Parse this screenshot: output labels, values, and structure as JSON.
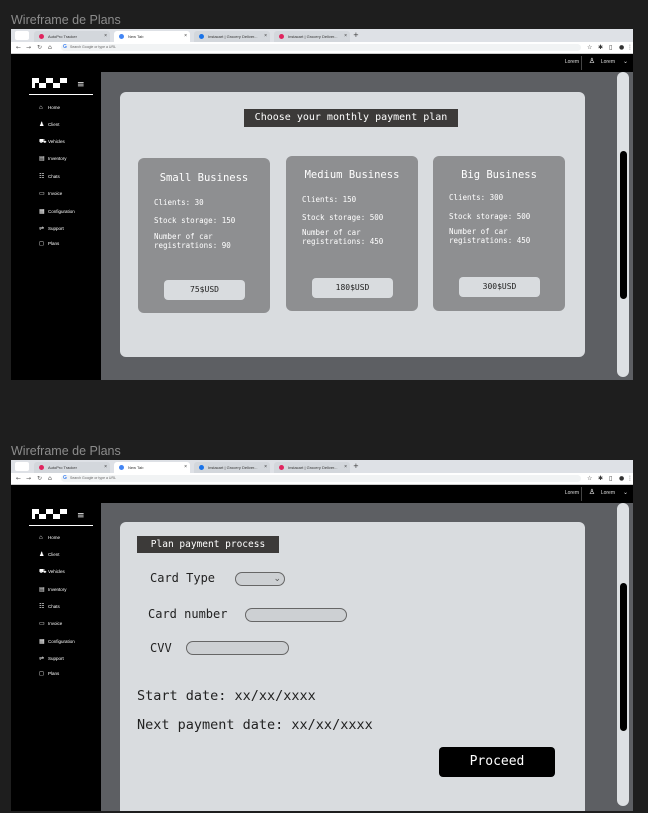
{
  "frame_title": "Wireframe de Plans",
  "browser": {
    "tabs": [
      {
        "label": "AutoPro Tracker",
        "fav_color": "#e0245e"
      },
      {
        "label": "New Tab",
        "fav_color": "#4285f4"
      },
      {
        "label": "Instacart | Grocery Deliver...",
        "fav_color": "#1a73e8"
      },
      {
        "label": "Instacart | Grocery Deliver...",
        "fav_color": "#e0245e"
      }
    ],
    "new_tab": "+",
    "close": "×",
    "address_placeholder": "Search Google or type a URL",
    "google_g": "G"
  },
  "header": {
    "lorem_left": "Lorem",
    "lorem_right": "Lorem",
    "user_icon": "user-icon"
  },
  "sidebar": {
    "items": [
      {
        "label": "Home",
        "icon": "⌂"
      },
      {
        "label": "Client",
        "icon": "♟"
      },
      {
        "label": "Vehicles",
        "icon": "⛟"
      },
      {
        "label": "Inventory",
        "icon": "▤"
      },
      {
        "label": "Chats",
        "icon": "☷"
      },
      {
        "label": "Invoice",
        "icon": "▭"
      },
      {
        "label": "Configuration",
        "icon": "▦"
      },
      {
        "label": "Support",
        "icon": "⇌"
      },
      {
        "label": "Plans",
        "icon": "◻"
      }
    ]
  },
  "plans_screen": {
    "heading": "Choose your monthly payment plan",
    "plans": [
      {
        "name": "Small Business",
        "clients": "Clients: 30",
        "storage": "Stock storage: 150",
        "registrations_l1": "Number of car",
        "registrations_l2": "registrations: 90",
        "price": "75$USD"
      },
      {
        "name": "Medium Business",
        "clients": "Clients: 150",
        "storage": "Stock storage: 500",
        "registrations_l1": "Number of car",
        "registrations_l2": "registrations: 450",
        "price": "180$USD"
      },
      {
        "name": "Big Business",
        "clients": "Clients: 300",
        "storage": "Stock storage: 500",
        "registrations_l1": "Number of car",
        "registrations_l2": "registrations: 450",
        "price": "300$USD"
      }
    ]
  },
  "payment_screen": {
    "heading": "Plan payment process",
    "card_type_label": "Card Type",
    "card_number_label": "Card number",
    "cvv_label": "CVV",
    "start_date": "Start date: xx/xx/xxxx",
    "next_payment_date": "Next payment date: xx/xx/xxxx",
    "proceed": "Proceed"
  },
  "colors": {
    "page_bg": "#1e1e1e",
    "content_bg": "#5d5f63",
    "card_bg": "#d9dcdf",
    "plan_bg": "#8e8f91",
    "heading_bg": "#3c3a39"
  }
}
